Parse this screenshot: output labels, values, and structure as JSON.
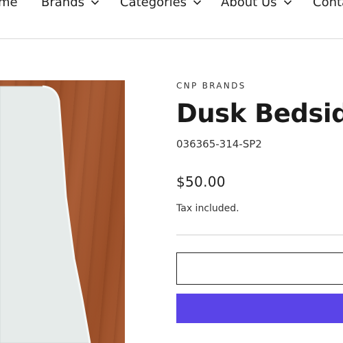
{
  "nav": {
    "items": [
      {
        "label": "me",
        "has_dropdown": false
      },
      {
        "label": "Brands",
        "has_dropdown": true
      },
      {
        "label": "Categories",
        "has_dropdown": true
      },
      {
        "label": "About Us",
        "has_dropdown": true
      },
      {
        "label": "Conta",
        "has_dropdown": false
      }
    ]
  },
  "product": {
    "brand": "CNP BRANDS",
    "title": "Dusk Bedside",
    "sku": "036365-314-SP2",
    "price": "$50.00",
    "tax_note": "Tax included."
  },
  "colors": {
    "primary_button": "#5a44e8",
    "text": "#1f1f1f",
    "divider": "#cfcfcf",
    "wood": "#a3532a"
  }
}
